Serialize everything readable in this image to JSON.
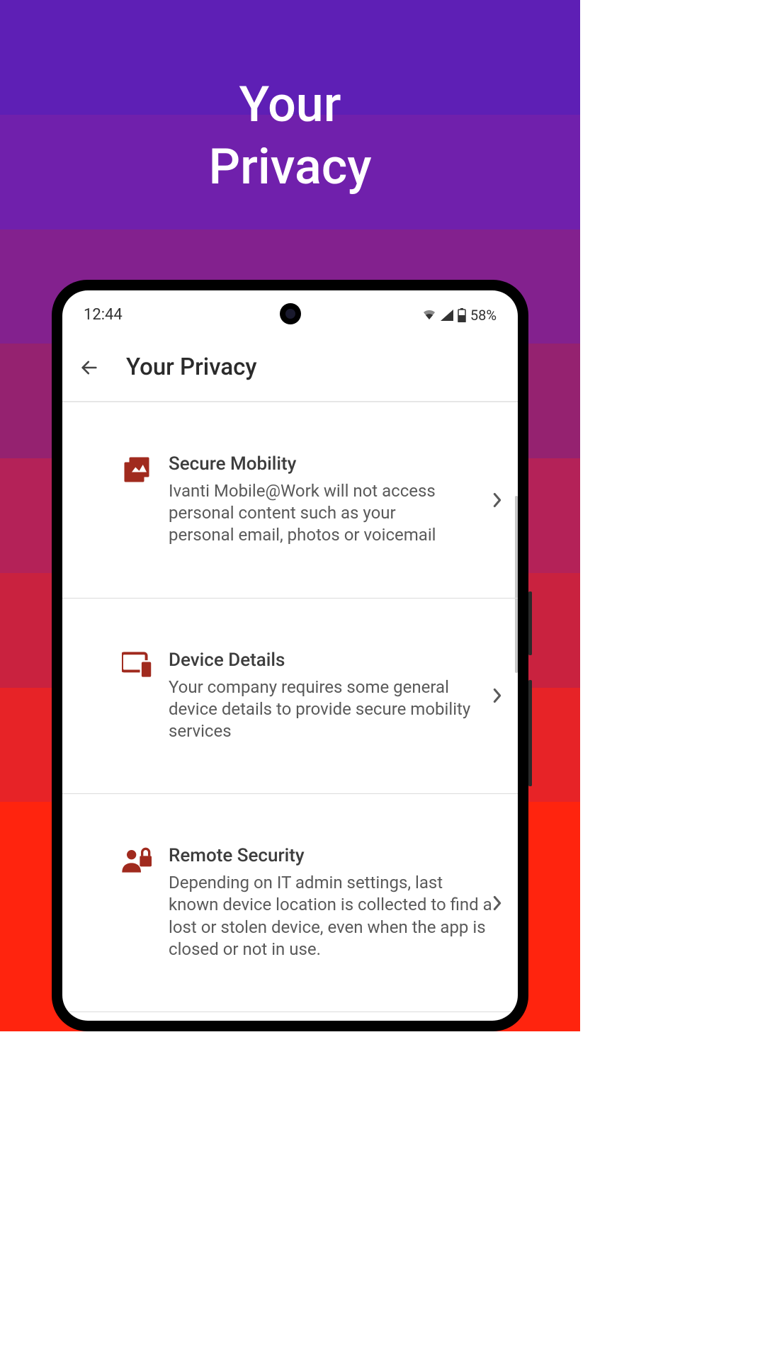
{
  "hero": {
    "line1": "Your",
    "line2": "Privacy"
  },
  "status": {
    "time": "12:44",
    "battery_percent": "58%"
  },
  "appbar": {
    "title": "Your Privacy"
  },
  "colors": {
    "accent": "#a02a1e"
  },
  "items": [
    {
      "icon": "photos-icon",
      "title": "Secure Mobility",
      "desc": "Ivanti Mobile@Work will not access personal content such as your personal email, photos or voicemail"
    },
    {
      "icon": "devices-icon",
      "title": "Device Details",
      "desc": "Your company requires some general device details to provide secure mobility services"
    },
    {
      "icon": "remote-security-icon",
      "title": "Remote Security",
      "desc": "Depending on IT admin settings, last known device location is collected to find a lost or stolen device, even when the app is closed or not in use."
    }
  ]
}
